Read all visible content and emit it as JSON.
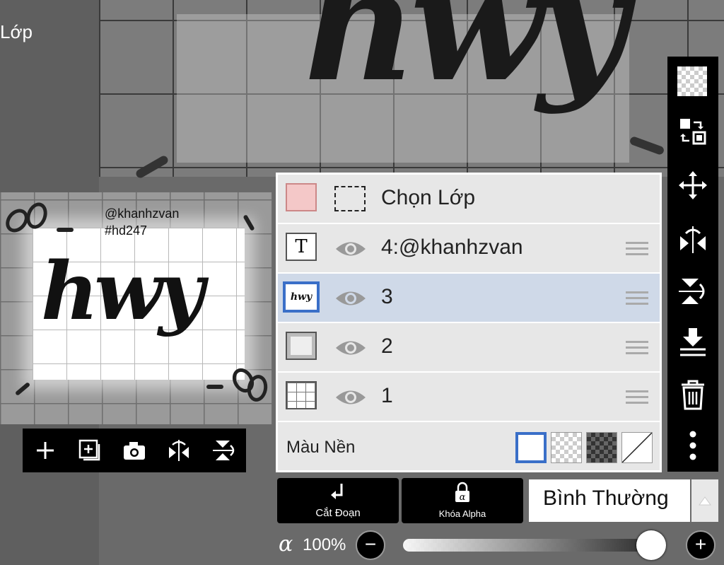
{
  "header": {
    "title": "Lớp"
  },
  "preview": {
    "watermark_line1": "@khanhzvan",
    "watermark_line2": "#hd247",
    "artwork_text": "hwy"
  },
  "preview_toolbar": [
    "add-layer-icon",
    "add-frame-icon",
    "camera-icon",
    "flip-horizontal-icon",
    "flip-vertical-icon"
  ],
  "layers_panel": {
    "select_row": {
      "label": "Chọn Lớp"
    },
    "layers": [
      {
        "name": "4:@khanhzvan",
        "type": "text",
        "visible": true,
        "selected": false
      },
      {
        "name": "3",
        "type": "image",
        "visible": true,
        "selected": true
      },
      {
        "name": "2",
        "type": "image",
        "visible": true,
        "selected": false
      },
      {
        "name": "1",
        "type": "image",
        "visible": true,
        "selected": false
      }
    ],
    "background": {
      "label": "Màu Nền",
      "options": [
        "white",
        "transparent",
        "dark-transparent",
        "none"
      ],
      "selected": "white"
    }
  },
  "right_toolbar": [
    "checker-icon",
    "swap-layer-icon",
    "move-icon",
    "flip-horizontal-icon",
    "flip-vertical-icon",
    "merge-down-icon",
    "trash-icon",
    "more-icon"
  ],
  "bottom": {
    "clip_label": "Cắt Đoạn",
    "alpha_lock_label": "Khóa Alpha",
    "blend_mode": "Bình Thường",
    "opacity_symbol": "α",
    "opacity_text": "100%",
    "opacity_value": 1.0
  },
  "colors": {
    "accent": "#3a6fc8",
    "selected_row": "#cfd9e8",
    "panel_bg": "#e7e7e7"
  }
}
